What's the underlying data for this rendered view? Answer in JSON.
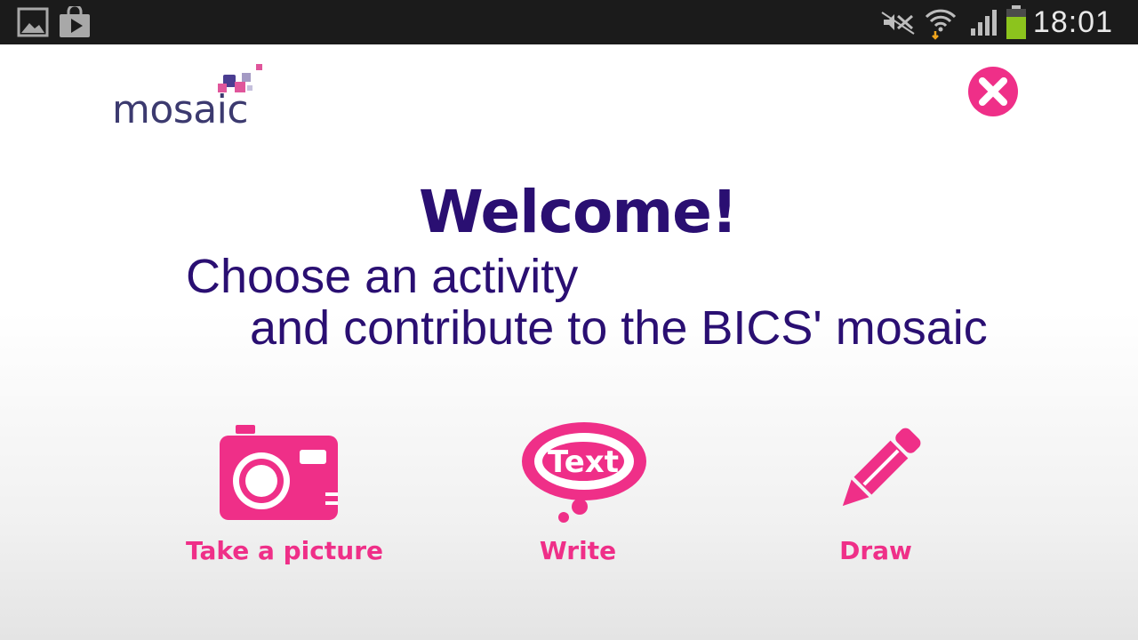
{
  "status_bar": {
    "time": "18:01",
    "icons": [
      "gallery-icon",
      "play-store-icon",
      "mute-icon",
      "wifi-icon",
      "signal-icon",
      "battery-icon"
    ]
  },
  "app": {
    "logo_text": "mosaic",
    "title": "Welcome!",
    "subtitle_line1": "Choose an activity",
    "subtitle_line2": "and contribute to the BICS' mosaic",
    "close_icon": "close-icon",
    "activities": [
      {
        "label": "Take a picture",
        "icon": "camera-icon"
      },
      {
        "label": "Write",
        "icon": "text-cloud-icon",
        "icon_text": "Text"
      },
      {
        "label": "Draw",
        "icon": "pencil-icon"
      }
    ]
  },
  "colors": {
    "accent": "#ef2f88",
    "title": "#2a0f72",
    "logo": "#3c3a6f",
    "status_bar": "#1b1b1b"
  }
}
